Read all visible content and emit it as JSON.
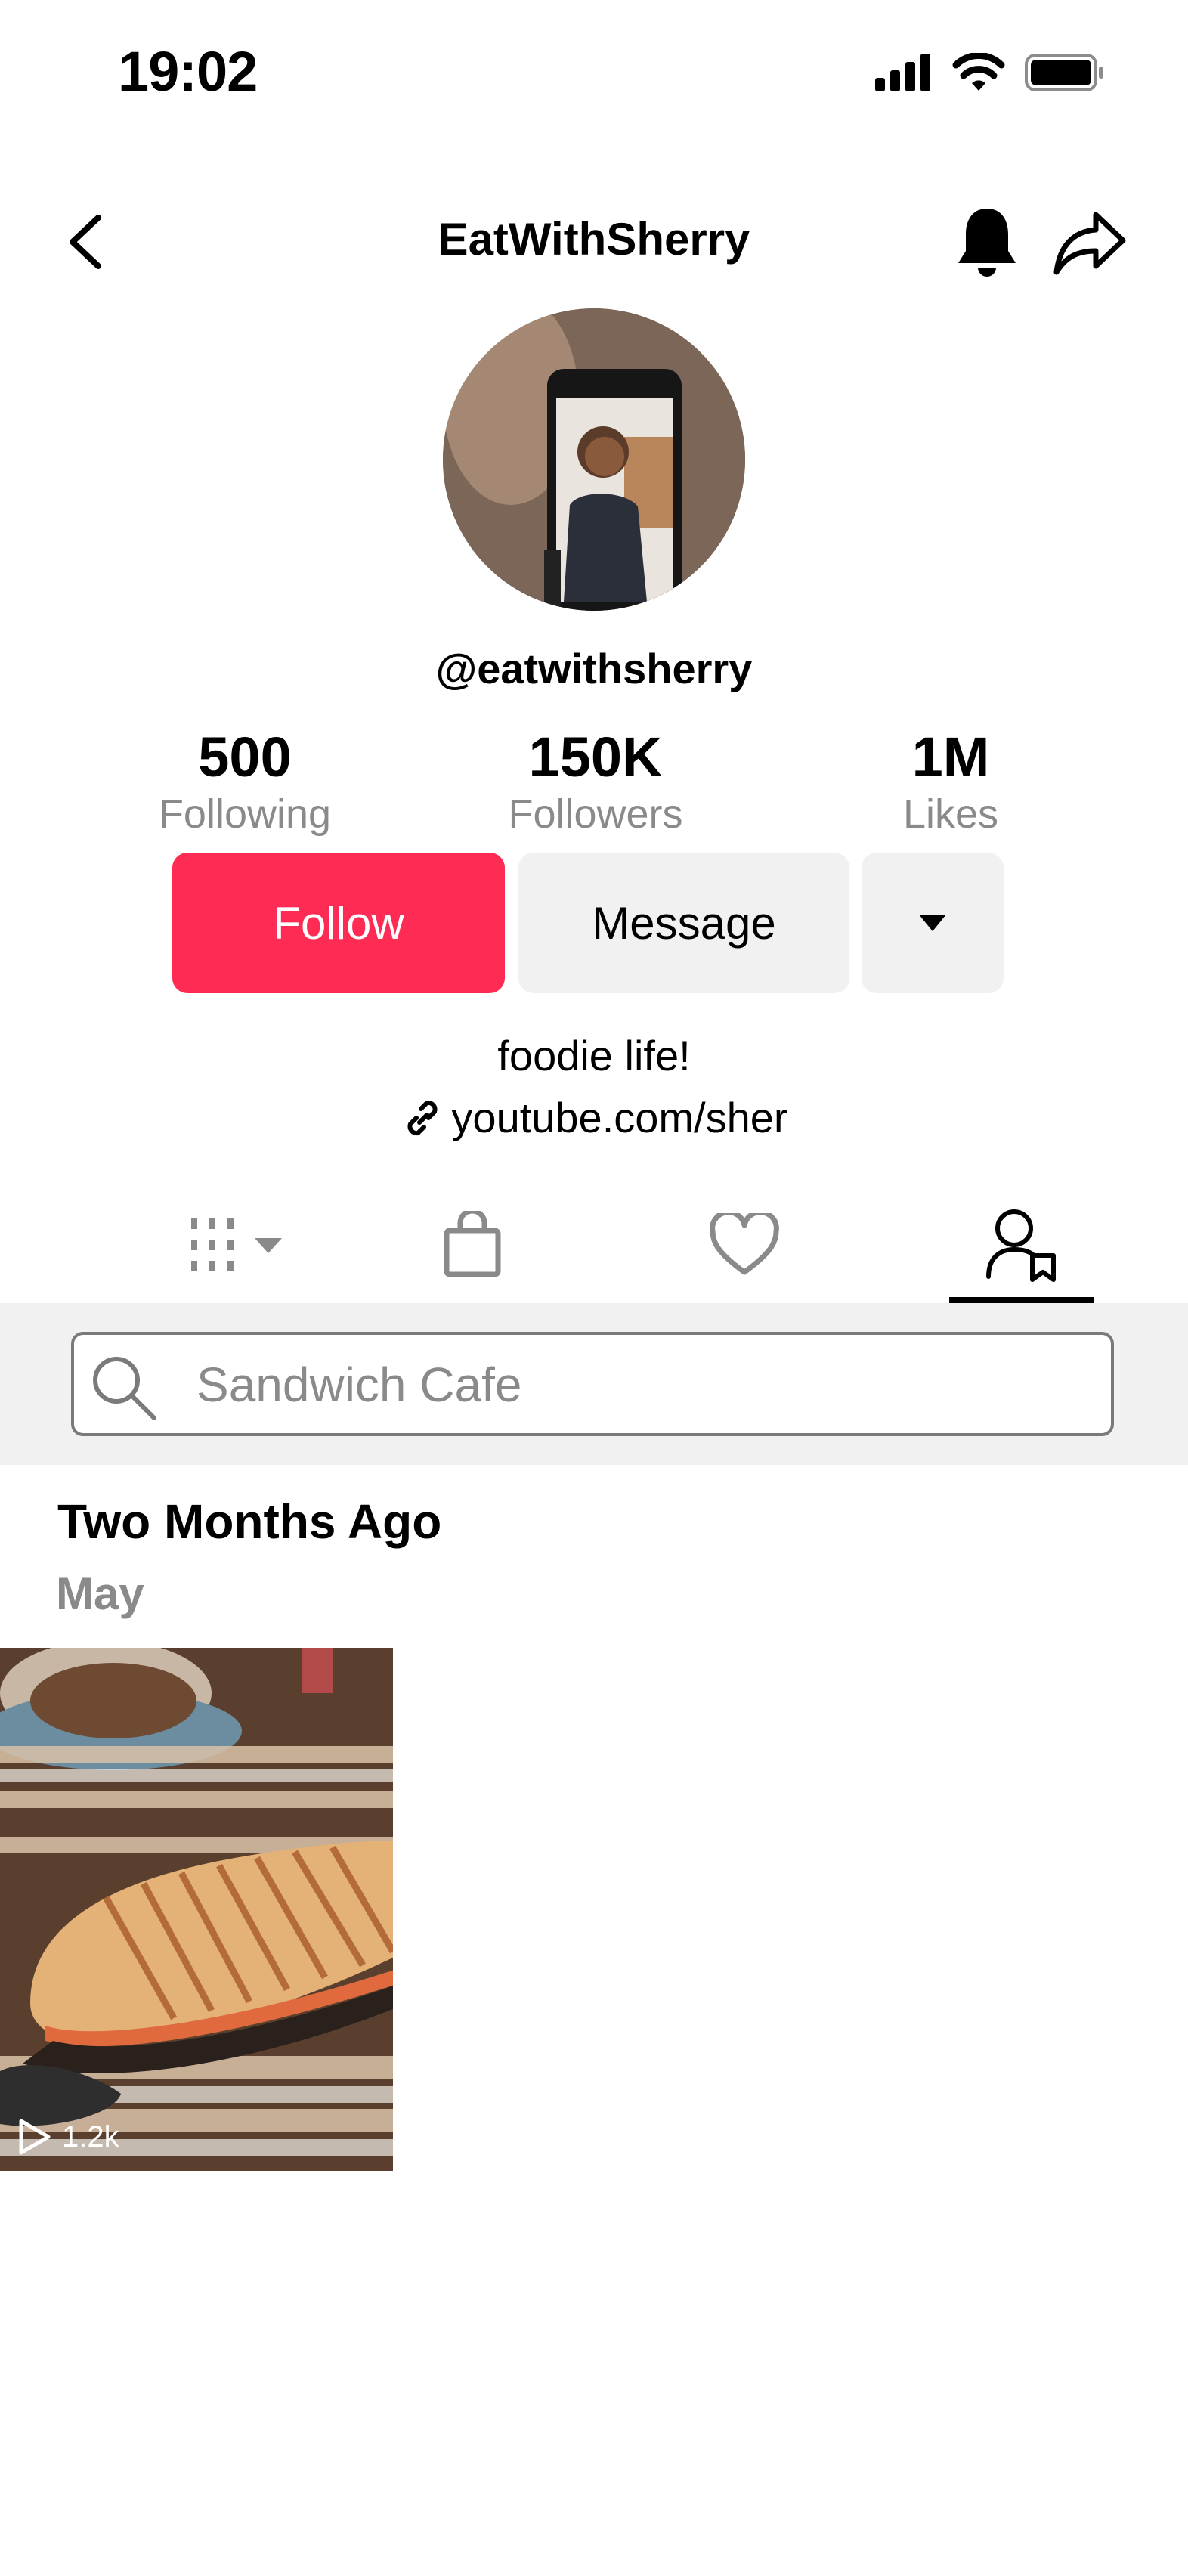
{
  "status_bar": {
    "time": "19:02"
  },
  "header": {
    "title": "EatWithSherry"
  },
  "profile": {
    "handle": "@eatwithsherry",
    "stats": [
      {
        "value": "500",
        "label": "Following"
      },
      {
        "value": "150K",
        "label": "Followers"
      },
      {
        "value": "1M",
        "label": "Likes"
      }
    ],
    "bio": "foodie life!",
    "link": "youtube.com/sher"
  },
  "actions": {
    "follow_label": "Follow",
    "message_label": "Message"
  },
  "tabs": {
    "icons": [
      "videos-grid-icon",
      "shopping-bag-icon",
      "heart-icon",
      "favorites-user-icon"
    ],
    "active_index": 3
  },
  "search": {
    "placeholder": "Sandwich Cafe"
  },
  "feed": {
    "section_title": "Two Months Ago",
    "section_subtitle": "May",
    "videos": [
      {
        "views": "1.2k"
      }
    ]
  },
  "colors": {
    "accent": "#fe2c55",
    "muted": "#8a8a8a",
    "button_bg": "#f1f1f1"
  }
}
